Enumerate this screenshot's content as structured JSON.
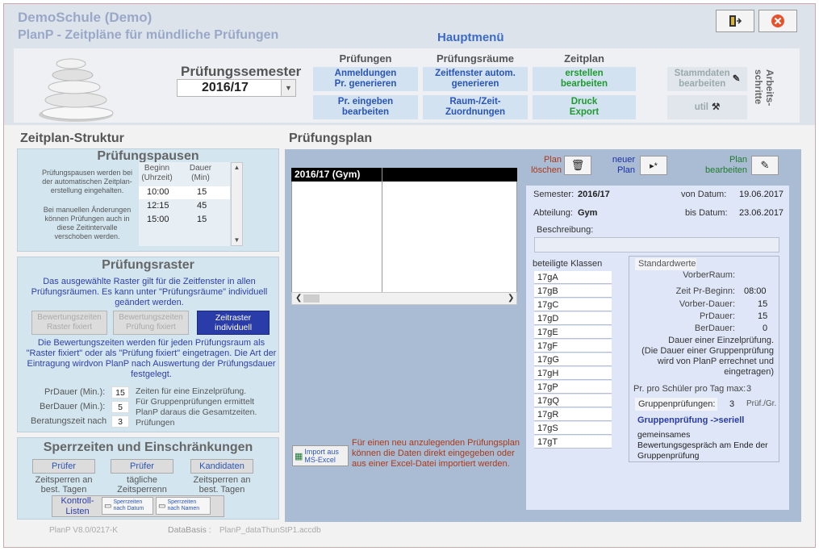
{
  "app": {
    "title1": "DemoSchule (Demo)",
    "title2": "PlanP - Zeitpläne für mündliche Prüfungen",
    "main_menu": "Hauptmenü"
  },
  "semester": {
    "label": "Prüfungssemester",
    "value": "2016/17"
  },
  "menu": {
    "pruefungen": {
      "head": "Prüfungen",
      "btn1": "Anmeldungen\nPr. generieren",
      "btn2": "Pr. eingeben\nbearbeiten"
    },
    "raeume": {
      "head": "Prüfungsräume",
      "btn1": "Zeitfenster autom.\ngenerieren",
      "btn2": "Raum-/Zeit-\nZuordnungen"
    },
    "zeitplan": {
      "head": "Zeitplan",
      "btn1": "erstellen\nbearbeiten",
      "btn2": "Druck\nExport"
    },
    "stammdaten": "Stammdaten\nbearbeiten",
    "util": "util",
    "arbeitsschritte": "Arbeits-\nschritte"
  },
  "left": {
    "struktur_title": "Zeitplan-Struktur",
    "pausen": {
      "title": "Prüfungspausen",
      "desc1": "Prüfungspausen werden bei der automatischen Zeitplan-erstellung eingehalten.",
      "desc2": "Bei manuellen Änderungen können Prüfungen auch in diese Zeitintervalle verschoben werden.",
      "col_beginn": "Beginn\n(Uhrzeit)",
      "col_dauer": "Dauer\n(Min)",
      "rows": [
        {
          "beginn": "10:00",
          "dauer": "15"
        },
        {
          "beginn": "12:15",
          "dauer": "45"
        },
        {
          "beginn": "15:00",
          "dauer": "15"
        }
      ]
    },
    "raster": {
      "title": "Prüfungsraster",
      "desc": "Das ausgewählte Raster gilt für die Zeitfenster in allen Prüfungsräumen. Es kann unter \"Prüfungsräume\" individuell geändert werden.",
      "btn1": "Bewertungszeiten\nRaster fixiert",
      "btn2": "Bewertungszeiten\nPrüfung fixiert",
      "btn3": "Zeitraster\nindividuell",
      "desc2": "Die Bewertungszeiten werden  für jeden Prüfungsraum als \"Raster fixiert\" oder als \"Prüfung fixiert\" eingetragen. Die Art der Eintragung wirdvon PlanP nach Auswertung der Prüfungsdauer festgelegt.",
      "prdauer_label": "PrDauer (Min.):",
      "prdauer_value": "15",
      "berdauer_label": "BerDauer (Min.):",
      "berdauer_value": "5",
      "beratung_label": "Beratungszeit nach",
      "beratung_value": "3",
      "note": "Zeiten für eine Einzelprüfung.\nFür Gruppenprüfungen ermittelt\nPlanP daraus die Gesamtzeiten.\nPrüfungen"
    },
    "sperr": {
      "title": "Sperrzeiten und Einschränkungen",
      "btn1": "Prüfer",
      "btn2": "Prüfer",
      "btn3": "Kandidaten",
      "sub1": "Zeitsperren an\nbest. Tagen",
      "sub2": "tägliche\nZeitsperrenn",
      "sub3": "Zeitsperren an\nbest. Tagen",
      "kontroll": "Kontroll-\nListen",
      "ctrl1": "Sperrzeiten\nnach Datum",
      "ctrl2": "Sperrzeiten\nnach Namen"
    }
  },
  "plan": {
    "title": "Prüfungsplan",
    "loeschen": "Plan\nlöschen",
    "neuer": "neuer\nPlan",
    "bearbeiten": "Plan\nbearbeiten",
    "list_head": "2016/17 (Gym)",
    "import_btn": "Import aus\nMS-Excel",
    "import_note": "Für einen neu anzulegenden Prüfungsplan können die Daten direkt eingegeben oder aus einer Excel-Datei importiert werden.",
    "semester_label": "Semester:",
    "semester_value": "2016/17",
    "abteilung_label": "Abteilung:",
    "abteilung_value": "Gym",
    "von_label": "von Datum:",
    "von_value": "19.06.2017",
    "bis_label": "bis Datum:",
    "bis_value": "23.06.2017",
    "beschreibung_label": "Beschreibung:",
    "klassen_label": "beteiligte Klassen",
    "klassen": [
      "17gA",
      "17gB",
      "17gC",
      "17gD",
      "17gE",
      "17gF",
      "17gG",
      "17gH",
      "17gP",
      "17gQ",
      "17gR",
      "17gS",
      "17gT"
    ],
    "std": {
      "title": "Standardwerte",
      "vorberraum": "VorberRaum:",
      "zeit_label": "Zeit Pr-Beginn:",
      "zeit_value": "08:00",
      "vorber_label": "Vorber-Dauer:",
      "vorber_value": "15",
      "pr_label": "PrDauer:",
      "pr_value": "15",
      "ber_label": "BerDauer:",
      "ber_value": "0",
      "note": "Dauer einer Einzelprüfung.\n(Die Dauer einer Gruppenprüfung\nwird von PlanP errechnet und\neingetragen)",
      "max_label": "Pr. pro Schüler pro Tag max:",
      "max_value": "3",
      "gruppe_label": "Gruppenprüfungen:",
      "gruppe_value": "3",
      "gruppe_unit": "Prüf./Gr.",
      "seriell": "Gruppenprüfung ->seriell",
      "seriell_note": "gemeinsames\nBewertungsgespräch am Ende der\nGruppenprüfung"
    }
  },
  "footer": {
    "version": "PlanP V8.0/0217-K",
    "db_label": "DataBasis :",
    "db_value": "PlanP_dataThunStP1.accdb"
  }
}
